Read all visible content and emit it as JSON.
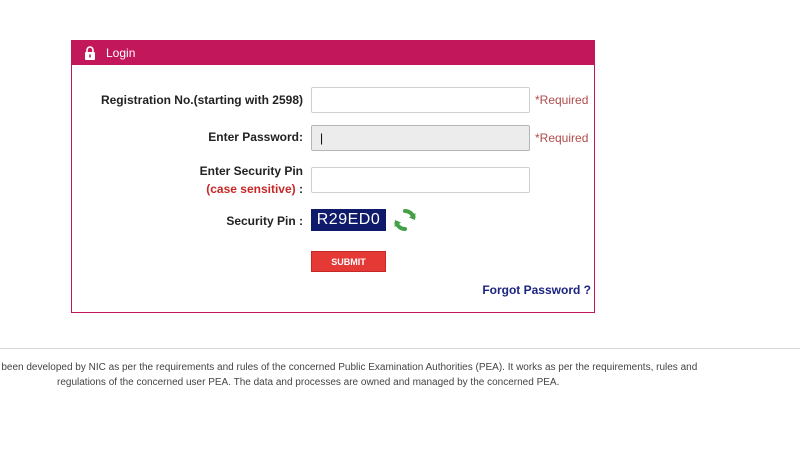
{
  "panel": {
    "title": "Login"
  },
  "form": {
    "registration": {
      "label": "Registration No.(starting with 2598)",
      "value": "",
      "required": "*Required"
    },
    "password": {
      "label": "Enter Password:",
      "value": "|",
      "required": "*Required"
    },
    "security_pin": {
      "label": "Enter Security Pin",
      "sub_label": "(case sensitive)",
      "sub_suffix": " :",
      "value": ""
    },
    "captcha": {
      "label": "Security Pin :",
      "code": "R29ED0"
    },
    "submit_label": "SUBMIT",
    "forgot_label": "Forgot Password ?"
  },
  "footer": {
    "line1": "as been developed by NIC as per the requirements and rules of the concerned Public Examination Authorities (PEA). It works as per the requirements, rules and",
    "line2": "regulations of the concerned user PEA. The data and processes are owned and managed by the concerned PEA."
  },
  "colors": {
    "brand": "#c2185b",
    "submit": "#e53935",
    "captcha_bg": "#0f1a6b",
    "link": "#1a237e",
    "required": "#b04a4a"
  },
  "icons": {
    "header": "lock-icon",
    "refresh": "refresh-icon"
  }
}
